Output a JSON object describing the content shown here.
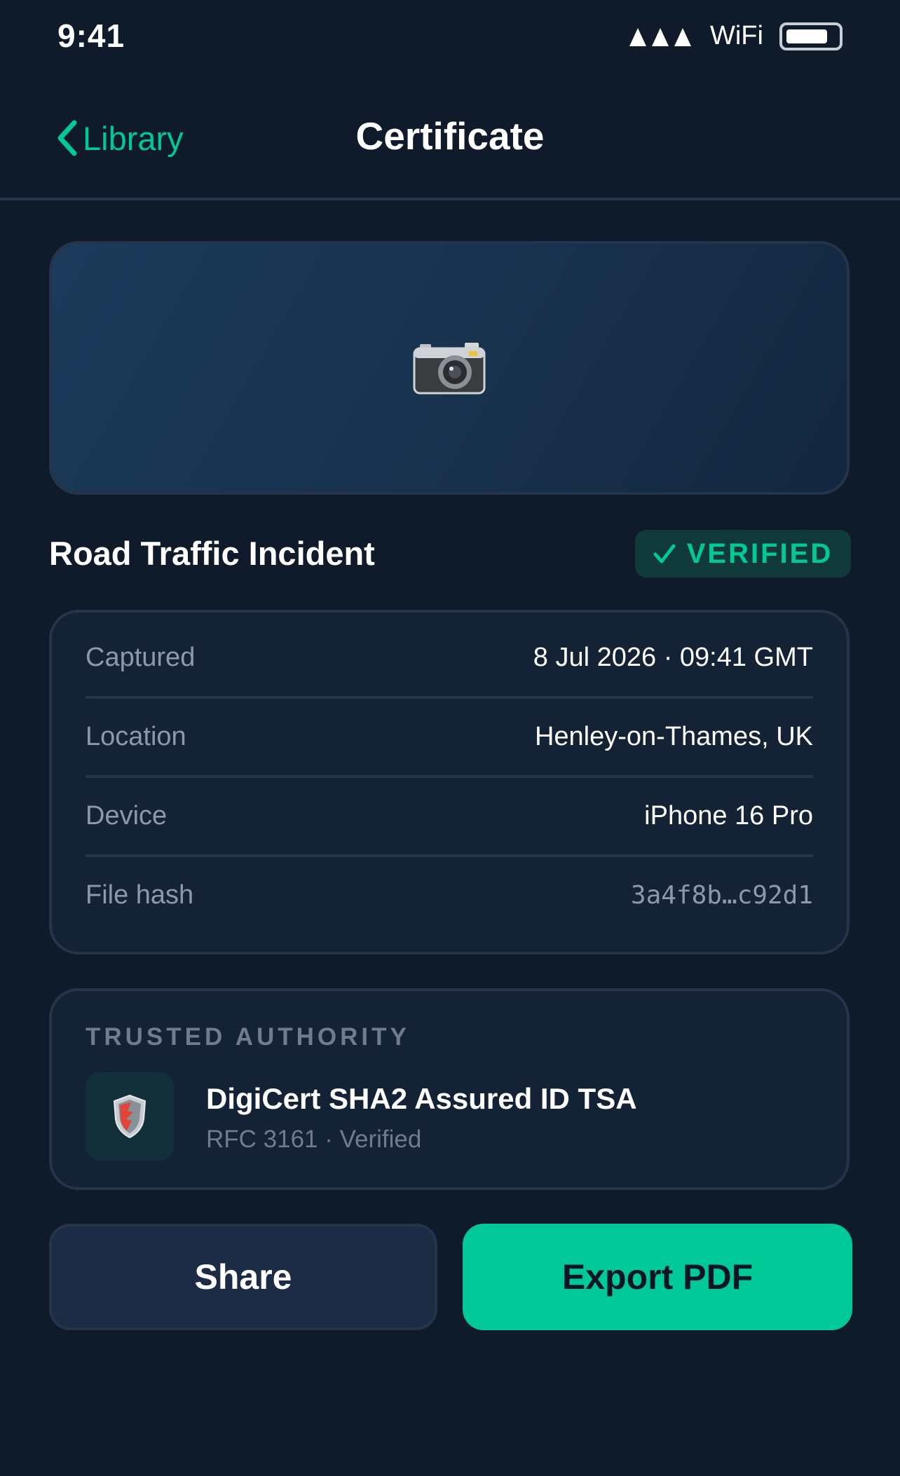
{
  "status_bar": {
    "time": "9:41",
    "wifi_label": "WiFi",
    "signal_icon": "signal-bars-icon",
    "battery_icon": "battery-icon"
  },
  "nav": {
    "back_label": "Library",
    "back_icon": "chevron-left-icon",
    "title": "Certificate"
  },
  "hero": {
    "icon": "camera-icon"
  },
  "incident": {
    "title": "Road Traffic Incident",
    "badge_label": "VERIFIED",
    "badge_icon": "check-icon"
  },
  "details": {
    "rows": [
      {
        "label": "Captured",
        "value": "8 Jul 2026 · 09:41 GMT"
      },
      {
        "label": "Location",
        "value": "Henley-on-Thames, UK"
      },
      {
        "label": "Device",
        "value": "iPhone 16 Pro"
      },
      {
        "label": "File hash",
        "value": "3a4f8b…c92d1"
      }
    ]
  },
  "authority": {
    "heading": "TRUSTED AUTHORITY",
    "name": "DigiCert SHA2 Assured ID TSA",
    "subtitle": "RFC 3161 · Verified",
    "icon": "shield-icon"
  },
  "actions": {
    "share_label": "Share",
    "export_label": "Export PDF"
  },
  "colors": {
    "background": "#0f1a2a",
    "card": "#142236",
    "border": "#25344a",
    "accent": "#00c896",
    "muted_text": "#8d99aa"
  }
}
